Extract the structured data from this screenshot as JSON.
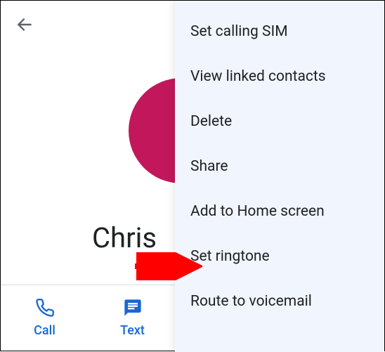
{
  "contact": {
    "name": "Chris",
    "avatar_color": "#C2185B"
  },
  "actions": {
    "call_label": "Call",
    "text_label": "Text"
  },
  "menu": {
    "items": [
      "Set calling SIM",
      "View linked contacts",
      "Delete",
      "Share",
      "Add to Home screen",
      "Set ringtone",
      "Route to voicemail"
    ]
  },
  "colors": {
    "accent": "#1967D2",
    "menu_bg": "#F1F6FE"
  }
}
